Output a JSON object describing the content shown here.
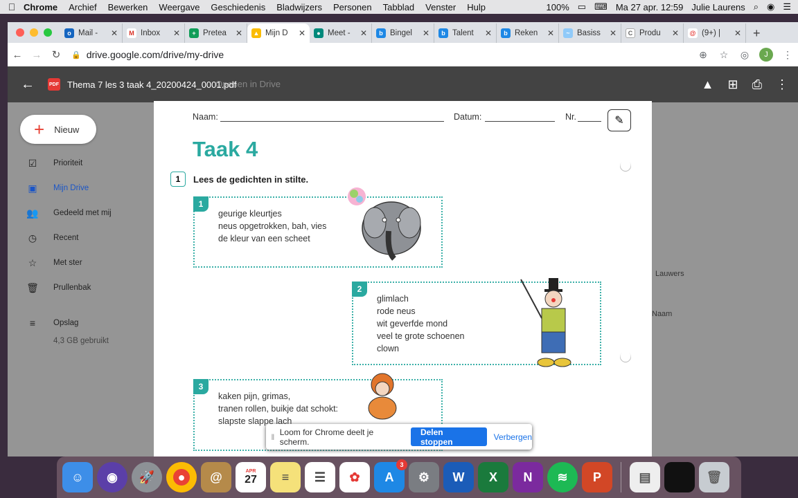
{
  "menubar": {
    "app": "Chrome",
    "items": [
      "Archief",
      "Bewerken",
      "Weergave",
      "Geschiedenis",
      "Bladwijzers",
      "Personen",
      "Tabblad",
      "Venster",
      "Hulp"
    ],
    "battery": "100%",
    "datetime": "Ma 27 apr. 12:59",
    "user": "Julie Laurens"
  },
  "tabs": [
    {
      "label": "Mail -",
      "icon": "outlook-icon",
      "color": "#1565c0"
    },
    {
      "label": "Inbox",
      "icon": "gmail-icon",
      "color": "#d93025"
    },
    {
      "label": "Pretea",
      "icon": "sheets-icon",
      "color": "#0f9d58"
    },
    {
      "label": "Mijn D",
      "icon": "drive-icon",
      "color": "#fbbc04"
    },
    {
      "label": "Meet -",
      "icon": "meet-icon",
      "color": "#00897b"
    },
    {
      "label": "Bingel",
      "icon": "bingel-icon",
      "color": "#1e88e5"
    },
    {
      "label": "Talent",
      "icon": "bingel-icon",
      "color": "#1e88e5"
    },
    {
      "label": "Reken",
      "icon": "bingel-icon",
      "color": "#1e88e5"
    },
    {
      "label": "Basiss",
      "icon": "link-icon",
      "color": "#90caf9"
    },
    {
      "label": "Produ",
      "icon": "c-icon",
      "color": "#9e9e9e"
    },
    {
      "label": "(9+) |",
      "icon": "swirl-icon",
      "color": "#e53935"
    }
  ],
  "omnibox": {
    "url": "drive.google.com/drive/my-drive"
  },
  "drive": {
    "new_label": "Nieuw",
    "nav": [
      {
        "label": "Prioriteit",
        "icon": "check-icon"
      },
      {
        "label": "Mijn Drive",
        "icon": "drive-folder-icon"
      },
      {
        "label": "Gedeeld met mij",
        "icon": "people-icon"
      },
      {
        "label": "Recent",
        "icon": "clock-icon"
      },
      {
        "label": "Met ster",
        "icon": "star-icon"
      },
      {
        "label": "Prullenbak",
        "icon": "trash-icon"
      },
      {
        "label": "Opslag",
        "icon": "storage-icon"
      }
    ],
    "storage_used": "4,3 GB gebruikt",
    "name_column": "Naam",
    "owner": "Lauwers"
  },
  "viewer": {
    "badge": "PDF",
    "filename": "Thema 7 les 3 taak 4_20200424_0001.pdf",
    "open_with": "Openen in Drive"
  },
  "worksheet": {
    "naam": "Naam:",
    "datum": "Datum:",
    "nr": "Nr.",
    "title": "Taak 4",
    "step": "1",
    "instruction": "Lees de gedichten in stilte.",
    "poems": [
      {
        "num": "1",
        "lines": [
          "geurige kleurtjes",
          "neus opgetrokken, bah, vies",
          "de kleur van een scheet"
        ]
      },
      {
        "num": "2",
        "lines": [
          "glimlach",
          "rode neus",
          "wit geverfde mond",
          "veel te grote schoenen",
          "clown"
        ]
      },
      {
        "num": "3",
        "lines": [
          "kaken pijn, grimas,",
          "tranen rollen, buikje dat schokt:",
          "slapste slappe lach"
        ]
      }
    ]
  },
  "loom": {
    "message": "Loom for Chrome deelt je scherm.",
    "stop": "Delen stoppen",
    "hide": "Verbergen"
  },
  "dock": {
    "calendar_month": "APR",
    "calendar_day": "27",
    "appstore_badge": "3"
  }
}
